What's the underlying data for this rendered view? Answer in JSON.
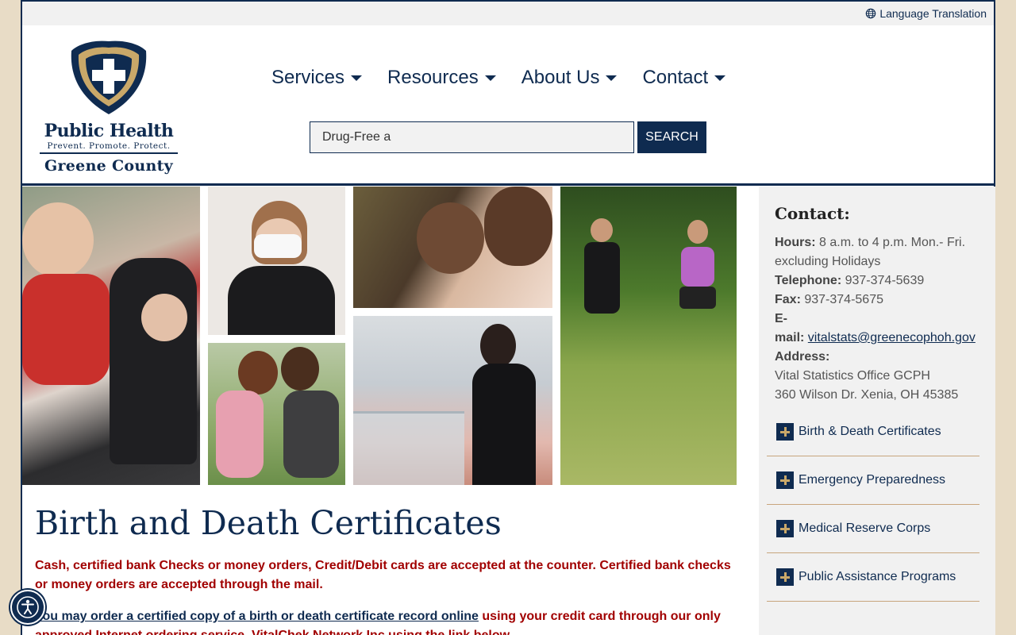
{
  "topbar": {
    "language_label": "Language Translation"
  },
  "logo": {
    "title": "Public Health",
    "tagline": "Prevent. Promote. Protect.",
    "county": "Greene County"
  },
  "nav": {
    "items": [
      {
        "label": "Services"
      },
      {
        "label": "Resources"
      },
      {
        "label": "About Us"
      },
      {
        "label": "Contact"
      }
    ]
  },
  "search": {
    "value": "Drug-Free a",
    "button_label": "SEARCH"
  },
  "page": {
    "title": "Birth and Death Certificates",
    "notice": "Cash, certified bank Checks or money orders, Credit/Debit cards are accepted at the counter. Certified bank checks or money orders are accepted through the mail.",
    "order_link": "You may order a certified copy of a birth or death certificate record online",
    "order_rest": " using your credit card through our only approved Internet ordering service, VitalChek Network Inc using the link below."
  },
  "sidebar": {
    "heading": "Contact:",
    "hours_label": "Hours:",
    "hours_value": " 8 a.m. to 4 p.m. Mon.- Fri. excluding Holidays",
    "phone_label": "Telephone:",
    "phone_value": " 937-374-5639",
    "fax_label": "Fax:",
    "fax_value": " 937-374-5675",
    "email_label_1": "E-",
    "email_label_2": "mail:",
    "email_value": "vitalstats@greenecophoh.gov",
    "address_label": "Address:",
    "address_line1": "Vital Statistics Office GCPH",
    "address_line2": "360 Wilson Dr. Xenia, OH 45385",
    "accordion": [
      {
        "label": "Birth & Death Certificates"
      },
      {
        "label": "Emergency Preparedness"
      },
      {
        "label": "Medical Reserve Corps"
      },
      {
        "label": "Public Assistance Programs"
      }
    ]
  },
  "colors": {
    "navy": "#0f2b50",
    "gold": "#c9a869",
    "alert_red": "#a10000",
    "page_bg": "#e8dcc6"
  }
}
